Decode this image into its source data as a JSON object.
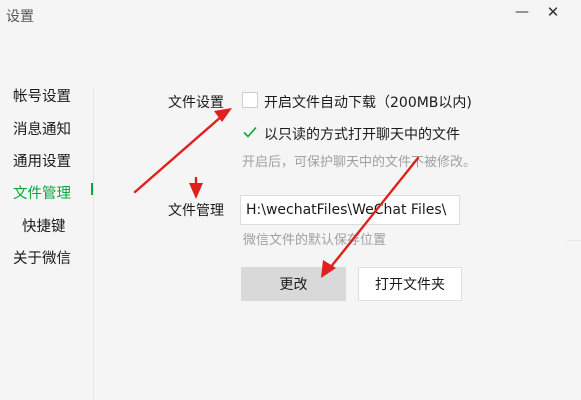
{
  "window": {
    "title": "设置",
    "minimize_glyph": "—",
    "close_glyph": "✕"
  },
  "sidebar": {
    "items": [
      {
        "label": "帐号设置"
      },
      {
        "label": "消息通知"
      },
      {
        "label": "通用设置"
      },
      {
        "label": "文件管理",
        "active": true
      },
      {
        "label": "快捷键"
      },
      {
        "label": "关于微信"
      }
    ]
  },
  "file_settings": {
    "label": "文件设置",
    "auto_download": {
      "label": "开启文件自动下载（200MB以内)",
      "checked": false
    },
    "read_only": {
      "label": "以只读的方式打开聊天中的文件",
      "checked": true
    },
    "read_only_hint": "开启后，可保护聊天中的文件不被修改。"
  },
  "file_management": {
    "label": "文件管理",
    "path_value": "H:\\wechatFiles\\WeChat Files\\",
    "path_hint": "微信文件的默认保存位置",
    "change_button": "更改",
    "open_folder_button": "打开文件夹"
  },
  "colors": {
    "accent": "#07a83b",
    "annotation_arrow": "#e0201c"
  }
}
